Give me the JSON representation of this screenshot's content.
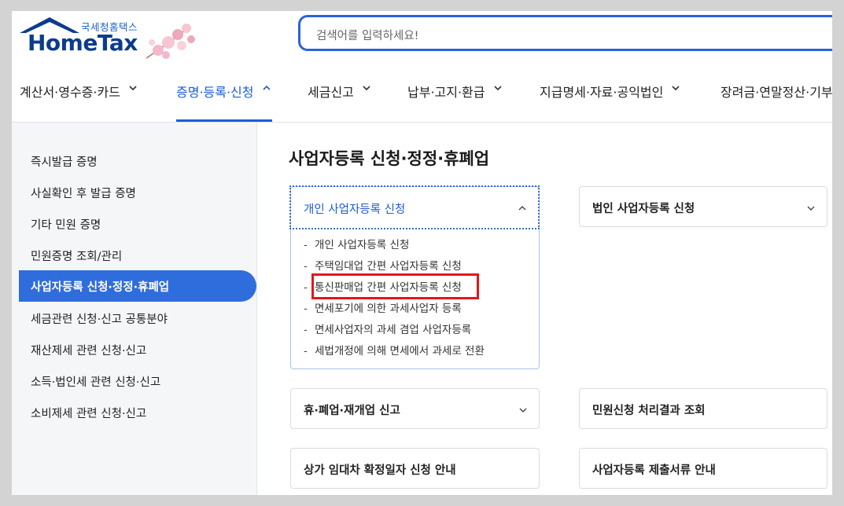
{
  "logo": {
    "sub": "국세청홈택스",
    "main": "HomeTax"
  },
  "search": {
    "placeholder": "검색어를 입력하세요!"
  },
  "nav": [
    {
      "label": "계산서·영수증·카드",
      "active": false
    },
    {
      "label": "증명·등록·신청",
      "active": true
    },
    {
      "label": "세금신고",
      "active": false
    },
    {
      "label": "납부·고지·환급",
      "active": false
    },
    {
      "label": "지급명세·자료·공익법인",
      "active": false
    },
    {
      "label": "장려금·연말정산·기부금",
      "active": false
    }
  ],
  "sidebar": {
    "items": [
      {
        "label": "즉시발급 증명"
      },
      {
        "label": "사실확인 후 발급 증명"
      },
      {
        "label": "기타 민원 증명"
      },
      {
        "label": "민원증명 조회/관리"
      },
      {
        "label": "사업자등록 신청·정정·휴폐업"
      },
      {
        "label": "세금관련 신청·신고 공통분야"
      },
      {
        "label": "재산제세 관련 신청·신고"
      },
      {
        "label": "소득·법인세 관련 신청·신고"
      },
      {
        "label": "소비제세 관련 신청·신고"
      }
    ]
  },
  "main": {
    "title": "사업자등록 신청·정정·휴폐업",
    "expanded_card": {
      "label": "개인 사업자등록 신청",
      "items": [
        "개인 사업자등록 신청",
        "주택임대업 간편 사업자등록 신청",
        "통신판매업 간편 사업자등록 신청",
        "면세포기에 의한 과세사업자 등록",
        "면세사업자의 과세 겸업 사업자등록",
        "세법개정에 의해 면세에서 과세로 전환"
      ]
    },
    "cards": {
      "corp_register": "법인 사업자등록 신청",
      "closure": "휴·폐업·재개업 신고",
      "civil_result": "민원신청 처리결과 조회",
      "lease_date": "상가 임대차 확정일자 신청 안내",
      "docs_guide": "사업자등록 제출서류 안내"
    }
  },
  "colors": {
    "accent": "#2f6ddc",
    "highlight": "#e8141b",
    "brand": "#0b3c8c"
  }
}
